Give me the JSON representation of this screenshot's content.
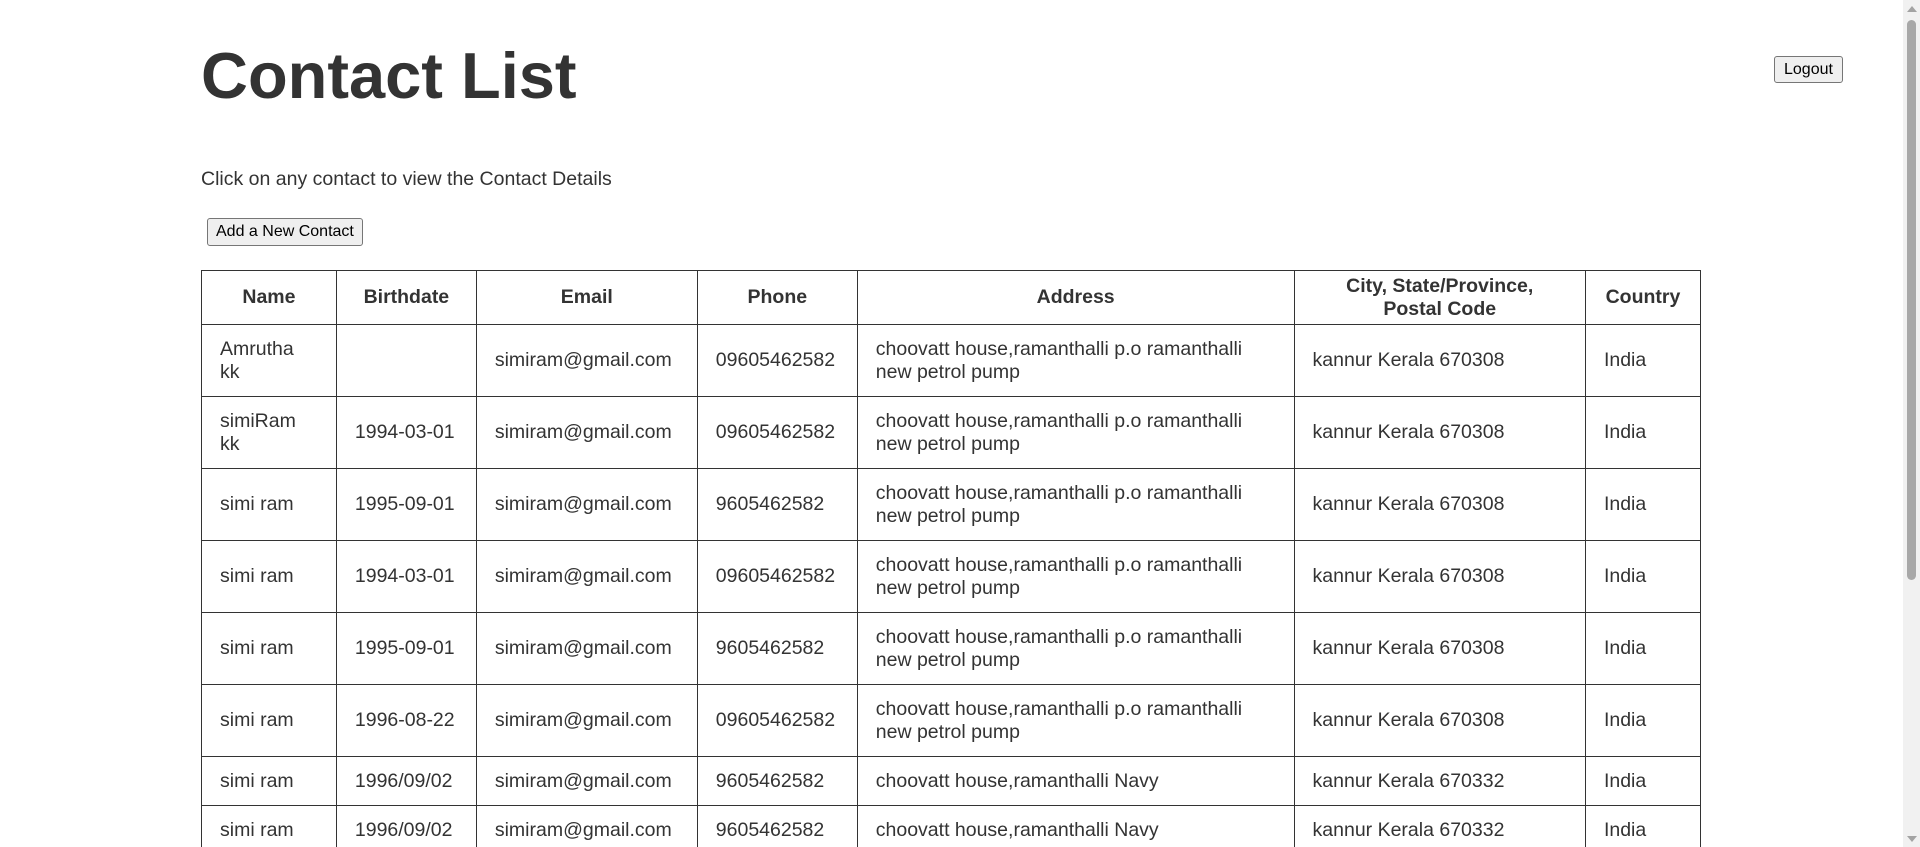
{
  "page": {
    "title": "Contact List",
    "logout_label": "Logout",
    "instruction": "Click on any contact to view the Contact Details",
    "add_contact_label": "Add a New Contact"
  },
  "table": {
    "headers": {
      "name": "Name",
      "birthdate": "Birthdate",
      "email": "Email",
      "phone": "Phone",
      "address": "Address",
      "city_line1": "City, State/Province,",
      "city_line2": "Postal Code",
      "country": "Country"
    },
    "rows": [
      {
        "name": "Amrutha kk",
        "birthdate": "",
        "email": "simiram@gmail.com",
        "phone": "09605462582",
        "address": "choovatt house,ramanthalli p.o ramanthalli new petrol pump",
        "city": "kannur Kerala 670308",
        "country": "India"
      },
      {
        "name": "simiRam kk",
        "birthdate": "1994-03-01",
        "email": "simiram@gmail.com",
        "phone": "09605462582",
        "address": "choovatt house,ramanthalli p.o ramanthalli new petrol pump",
        "city": "kannur Kerala 670308",
        "country": "India"
      },
      {
        "name": "simi ram",
        "birthdate": "1995-09-01",
        "email": "simiram@gmail.com",
        "phone": "9605462582",
        "address": "choovatt house,ramanthalli p.o ramanthalli new petrol pump",
        "city": "kannur Kerala 670308",
        "country": "India"
      },
      {
        "name": "simi ram",
        "birthdate": "1994-03-01",
        "email": "simiram@gmail.com",
        "phone": "09605462582",
        "address": "choovatt house,ramanthalli p.o ramanthalli new petrol pump",
        "city": "kannur Kerala 670308",
        "country": "India"
      },
      {
        "name": "simi ram",
        "birthdate": "1995-09-01",
        "email": "simiram@gmail.com",
        "phone": "9605462582",
        "address": "choovatt house,ramanthalli p.o ramanthalli new petrol pump",
        "city": "kannur Kerala 670308",
        "country": "India"
      },
      {
        "name": "simi ram",
        "birthdate": "1996-08-22",
        "email": "simiram@gmail.com",
        "phone": "09605462582",
        "address": "choovatt house,ramanthalli p.o ramanthalli new petrol pump",
        "city": "kannur Kerala 670308",
        "country": "India"
      },
      {
        "name": "simi ram",
        "birthdate": "1996/09/02",
        "email": "simiram@gmail.com",
        "phone": "9605462582",
        "address": "choovatt house,ramanthalli Navy",
        "city": "kannur Kerala 670332",
        "country": "India"
      },
      {
        "name": "simi ram",
        "birthdate": "1996/09/02",
        "email": "simiram@gmail.com",
        "phone": "9605462582",
        "address": "choovatt house,ramanthalli Navy",
        "city": "kannur Kerala 670332",
        "country": "India"
      }
    ]
  },
  "scrollbar": {
    "up_icon": "arrow-up-icon",
    "down_icon": "arrow-down-icon"
  }
}
